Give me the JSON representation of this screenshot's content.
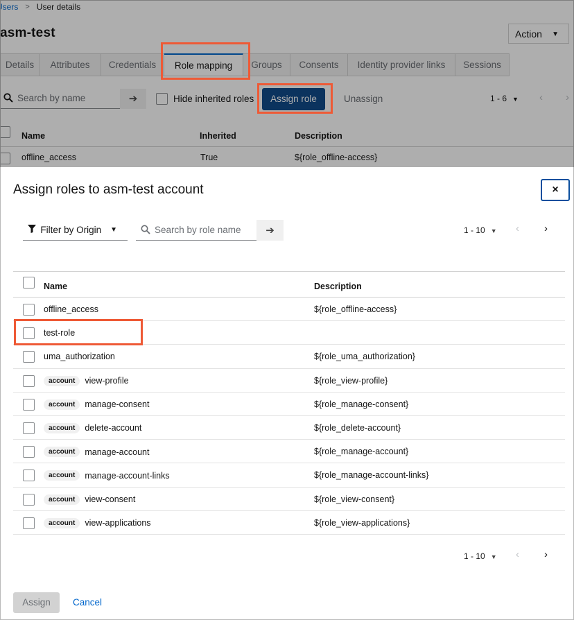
{
  "breadcrumb": {
    "parent": "Users",
    "separator": ">",
    "current": "User details"
  },
  "page": {
    "title": "asm-test",
    "action_label": "Action"
  },
  "tabs": [
    {
      "label": "Details"
    },
    {
      "label": "Attributes"
    },
    {
      "label": "Credentials"
    },
    {
      "label": "Role mapping"
    },
    {
      "label": "Groups"
    },
    {
      "label": "Consents"
    },
    {
      "label": "Identity provider links"
    },
    {
      "label": "Sessions"
    }
  ],
  "toolbar": {
    "search_placeholder": "Search by name",
    "hide_inherited_label": "Hide inherited roles",
    "assign_role_label": "Assign role",
    "unassign_label": "Unassign",
    "pagination": "1 - 6"
  },
  "bg_table": {
    "columns": [
      "Name",
      "Inherited",
      "Description"
    ],
    "rows": [
      {
        "name": "offline_access",
        "inherited": "True",
        "description": "${role_offline-access}"
      }
    ]
  },
  "modal": {
    "title": "Assign roles to asm-test account",
    "close_glyph": "×",
    "filter_label": "Filter by Origin",
    "search_placeholder": "Search by role name",
    "pagination": "1 - 10",
    "columns": {
      "name": "Name",
      "description": "Description"
    },
    "rows": [
      {
        "badge": "",
        "name": "offline_access",
        "description": "${role_offline-access}"
      },
      {
        "badge": "",
        "name": "test-role",
        "description": ""
      },
      {
        "badge": "",
        "name": "uma_authorization",
        "description": "${role_uma_authorization}"
      },
      {
        "badge": "account",
        "name": "view-profile",
        "description": "${role_view-profile}"
      },
      {
        "badge": "account",
        "name": "manage-consent",
        "description": "${role_manage-consent}"
      },
      {
        "badge": "account",
        "name": "delete-account",
        "description": "${role_delete-account}"
      },
      {
        "badge": "account",
        "name": "manage-account",
        "description": "${role_manage-account}"
      },
      {
        "badge": "account",
        "name": "manage-account-links",
        "description": "${role_manage-account-links}"
      },
      {
        "badge": "account",
        "name": "view-consent",
        "description": "${role_view-consent}"
      },
      {
        "badge": "account",
        "name": "view-applications",
        "description": "${role_view-applications}"
      }
    ],
    "assign_label": "Assign",
    "cancel_label": "Cancel"
  },
  "icons": {
    "search": "search-icon",
    "arrow_right": "arrow-right-icon",
    "caret_down": "caret-down-icon",
    "chevron_left": "chevron-left-icon",
    "chevron_right": "chevron-right-icon",
    "filter": "filter-icon",
    "close": "close-icon"
  },
  "colors": {
    "primary": "#0066cc",
    "assign_role_button": "#0f4a8a",
    "highlight": "#ee5a36",
    "disabled_button": "#d2d2d2"
  }
}
